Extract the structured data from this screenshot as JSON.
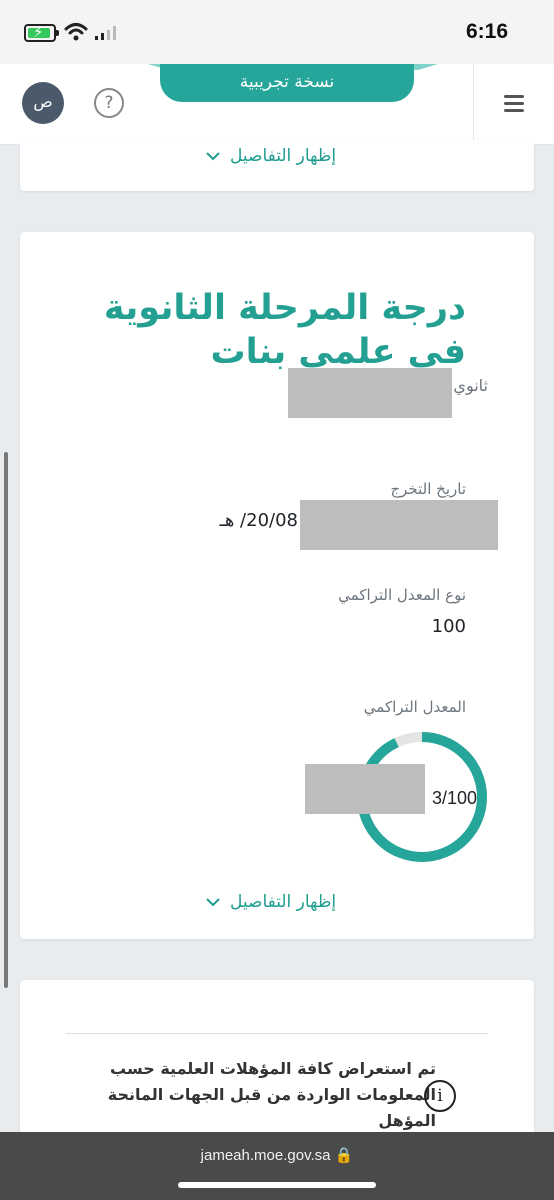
{
  "status_bar": {
    "time": "6:16"
  },
  "header": {
    "banner": "نسخة تجريبية",
    "avatar_initial": "ص",
    "help_icon": "?"
  },
  "card_top": {
    "details_label": "إظهار التفاصيل"
  },
  "card_main": {
    "title": "درجة المرحلة الثانوية في علمي بنات",
    "school_partial": "ثانوي",
    "graduation_date": {
      "label": "تاريخ التخرج",
      "value": "20/08/ هـ"
    },
    "gpa_type": {
      "label": "نوع المعدل التراكمي",
      "value": "100"
    },
    "gpa": {
      "label": "المعدل التراكمي",
      "value_partial": "3",
      "max": "/100",
      "fraction": 0.93
    },
    "details_label": "إظهار التفاصيل"
  },
  "info_card": {
    "text": "تم استعراض كافة المؤهلات العلمية حسب المعلومات الواردة من قبل الجهات المانحة المؤهل",
    "icon": "i"
  },
  "browser": {
    "url": "jameah.moe.gov.sa"
  },
  "colors": {
    "accent": "#26a69a",
    "text_accent": "#1f9e8f",
    "redaction": "#bdbdbd"
  }
}
